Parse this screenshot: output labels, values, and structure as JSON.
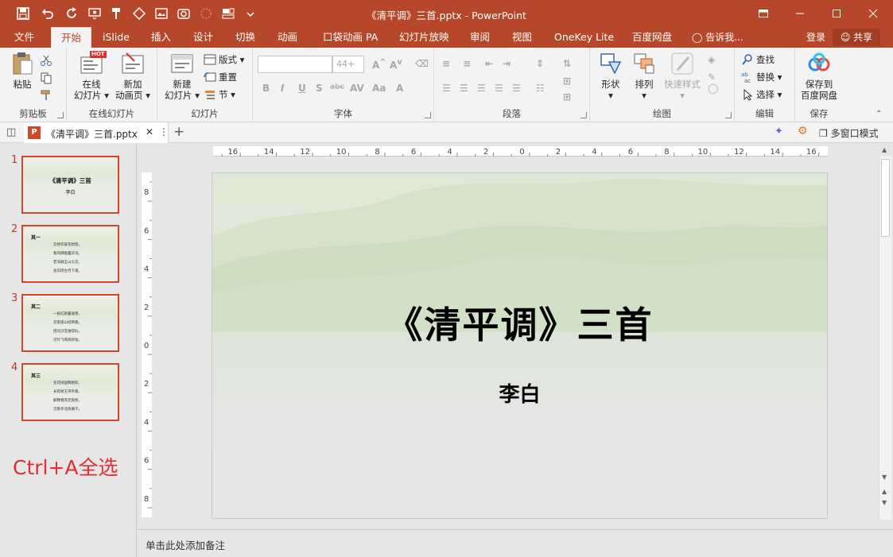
{
  "window": {
    "title": "《清平调》三首.pptx - PowerPoint",
    "accent": "#b7472a",
    "quick_access_icons": [
      "save-icon",
      "undo-icon",
      "redo-icon",
      "start-from-beginning-icon",
      "format-painter-icon",
      "shape-icon",
      "image-icon",
      "screenshot-icon",
      "lasso-icon",
      "layout-icon",
      "more-icon"
    ],
    "controls": [
      "ribbon-display-icon",
      "minimize-icon",
      "maximize-icon",
      "close-icon"
    ]
  },
  "tabs": [
    "文件",
    "开始",
    "iSlide",
    "插入",
    "设计",
    "切换",
    "动画",
    "口袋动画 PA",
    "幻灯片放映",
    "审阅",
    "视图",
    "OneKey Lite",
    "百度网盘"
  ],
  "active_tab": "开始",
  "tell_me": "告诉我...",
  "account": {
    "login": "登录",
    "share": "共享"
  },
  "ribbon": {
    "clipboard": {
      "label": "剪贴板",
      "paste": "粘贴"
    },
    "online_slides": {
      "label": "在线幻灯片",
      "online_slide_1": "在线",
      "online_slide_2": "幻灯片",
      "hot": "HOT",
      "add_anim_1": "新加",
      "add_anim_2": "动画页"
    },
    "slides": {
      "label": "幻灯片",
      "new_slide_1": "新建",
      "new_slide_2": "幻灯片",
      "layout": "版式",
      "reset": "重置",
      "section": "节"
    },
    "font": {
      "label": "字体",
      "font_size": "44+",
      "bold": "B",
      "italic": "I",
      "underline": "U",
      "shadow": "S",
      "strike": "abc"
    },
    "paragraph": {
      "label": "段落"
    },
    "drawing": {
      "label": "绘图",
      "shape": "形状",
      "arrange": "排列",
      "quick_style": "快速样式"
    },
    "editing": {
      "label": "编辑",
      "find": "查找",
      "replace": "替换",
      "select": "选择"
    },
    "save": {
      "label": "保存",
      "save_to_1": "保存到",
      "save_to_2": "百度网盘"
    }
  },
  "document_tab": {
    "name": "《清平调》三首.pptx"
  },
  "multi_window": "多窗口模式",
  "thumbnails": [
    {
      "num": "1",
      "title": "《清平调》三首",
      "author": "李白"
    },
    {
      "num": "2",
      "heading": "其一",
      "lines": [
        "云想衣裳花想容，",
        "春风拂槛露华浓。",
        "若非群玉山头见，",
        "会向瑶台月下逢。"
      ]
    },
    {
      "num": "3",
      "heading": "其二",
      "lines": [
        "一枝红艳露凝香，",
        "云雨巫山枉断肠。",
        "借问汉宫谁得似，",
        "可怜飞燕倚新妆。"
      ]
    },
    {
      "num": "4",
      "heading": "其三",
      "lines": [
        "名花倾国两相欢，",
        "长得君王带笑看。",
        "解释春风无限恨，",
        "沉香亭北倚阑干。"
      ]
    }
  ],
  "overlay_hint": "Ctrl+A全选",
  "ruler": {
    "h_labels": [
      "16",
      "14",
      "12",
      "10",
      "8",
      "6",
      "4",
      "2",
      "0",
      "2",
      "4",
      "6",
      "8",
      "10",
      "12",
      "14",
      "16"
    ],
    "v_labels": [
      "8",
      "6",
      "4",
      "2",
      "0",
      "2",
      "4",
      "6",
      "8"
    ]
  },
  "slide": {
    "title": "《清平调》三首",
    "author": "李白"
  },
  "notes_placeholder": "单击此处添加备注"
}
